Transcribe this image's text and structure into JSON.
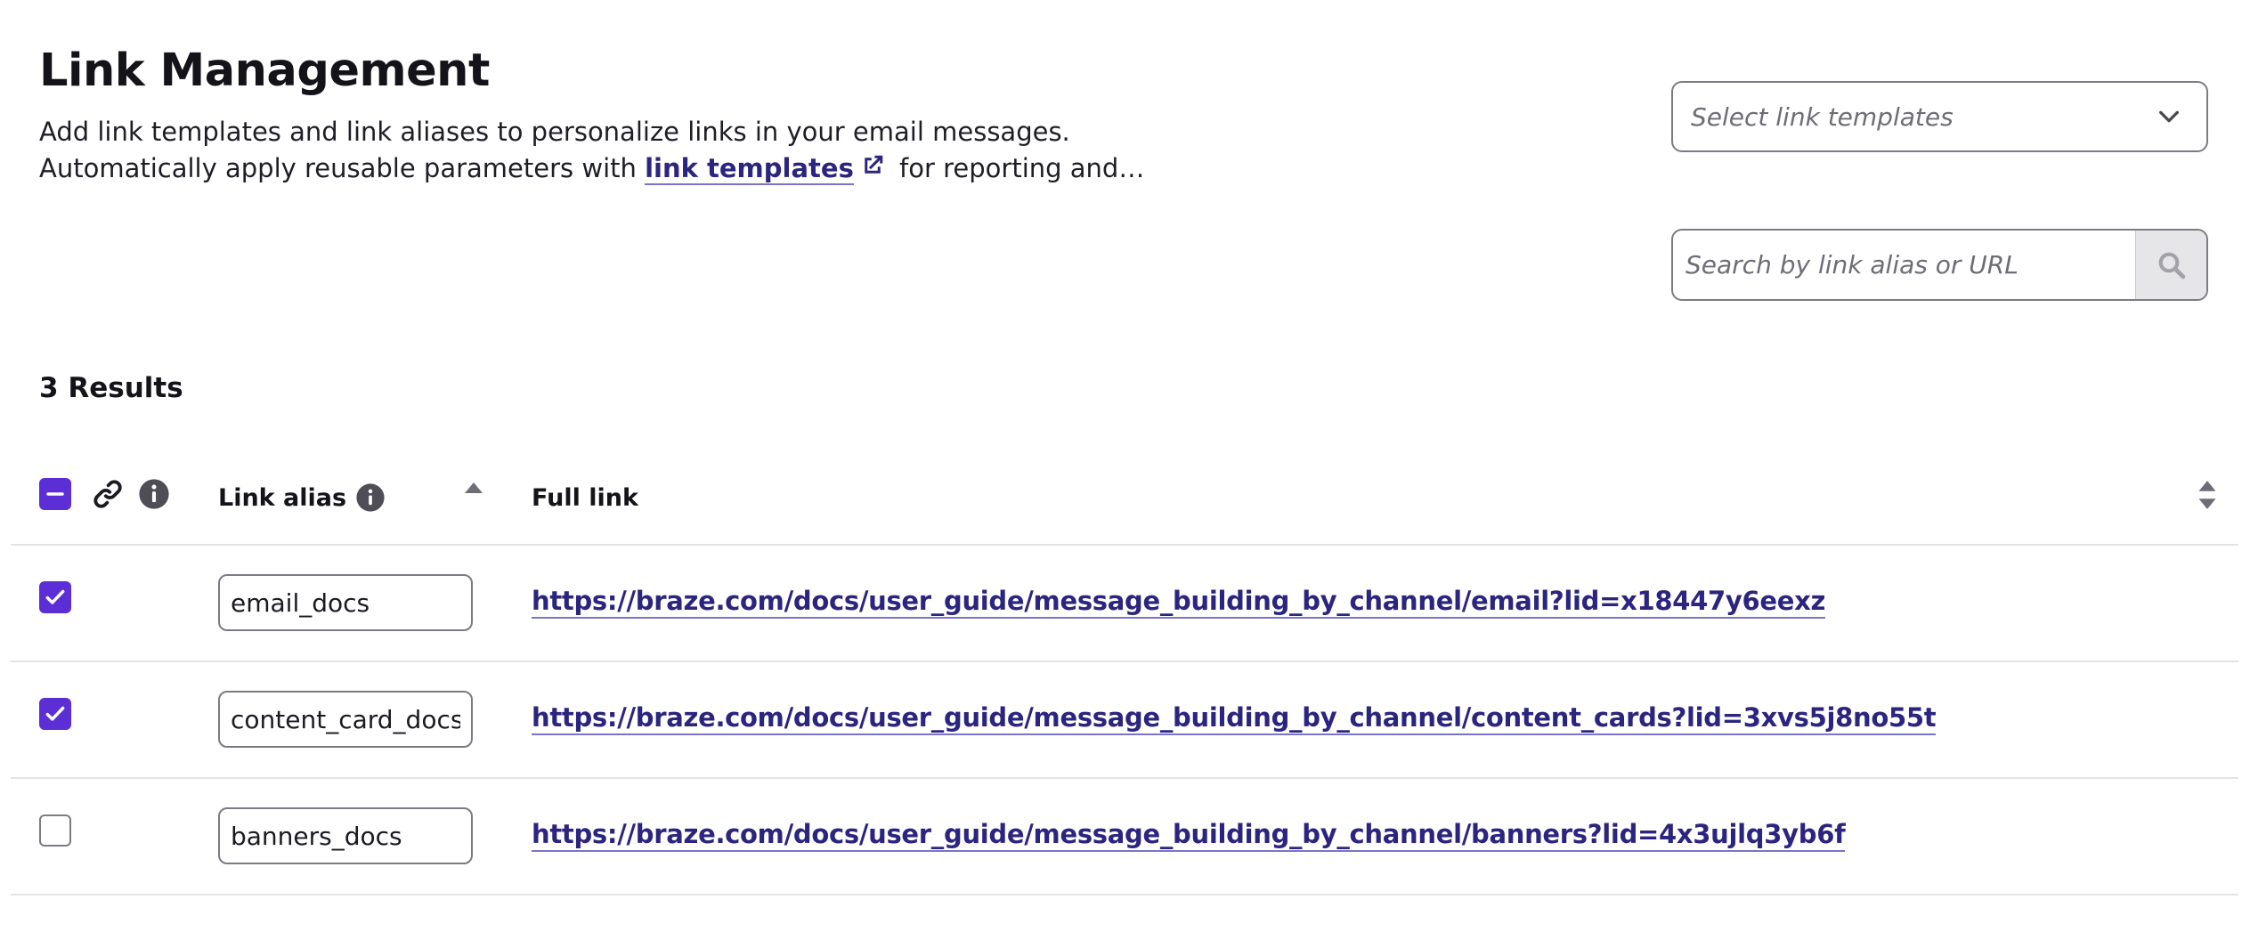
{
  "header": {
    "title": "Link Management",
    "description_line1": "Add link templates and link aliases to personalize links in your email messages.",
    "description_line2_prefix": "Automatically apply reusable parameters with ",
    "description_link": "link templates",
    "description_line2_suffix": " for reporting and…"
  },
  "controls": {
    "template_select_placeholder": "Select link templates",
    "search_placeholder": "Search by link alias or URL"
  },
  "results": {
    "count_label": "3 Results"
  },
  "table": {
    "columns": {
      "alias": "Link alias",
      "full_link": "Full link"
    },
    "rows": [
      {
        "checked": true,
        "alias": "email_docs",
        "full_link": "https://braze.com/docs/user_guide/message_building_by_channel/email?lid=x18447y6eexz"
      },
      {
        "checked": true,
        "alias": "content_card_docs",
        "full_link": "https://braze.com/docs/user_guide/message_building_by_channel/content_cards?lid=3xvs5j8no55t"
      },
      {
        "checked": false,
        "alias": "banners_docs",
        "full_link": "https://braze.com/docs/user_guide/message_building_by_channel/banners?lid=4x3ujlq3yb6f"
      }
    ]
  },
  "colors": {
    "accent": "#5c2fd6",
    "link": "#2b2580",
    "border": "#7c7b84"
  },
  "icons": [
    "external-link-icon",
    "chevron-down-icon",
    "search-icon",
    "chain-link-icon",
    "info-icon",
    "sort-ascending-icon",
    "sort-icon",
    "checkmark-icon",
    "minus-icon"
  ]
}
